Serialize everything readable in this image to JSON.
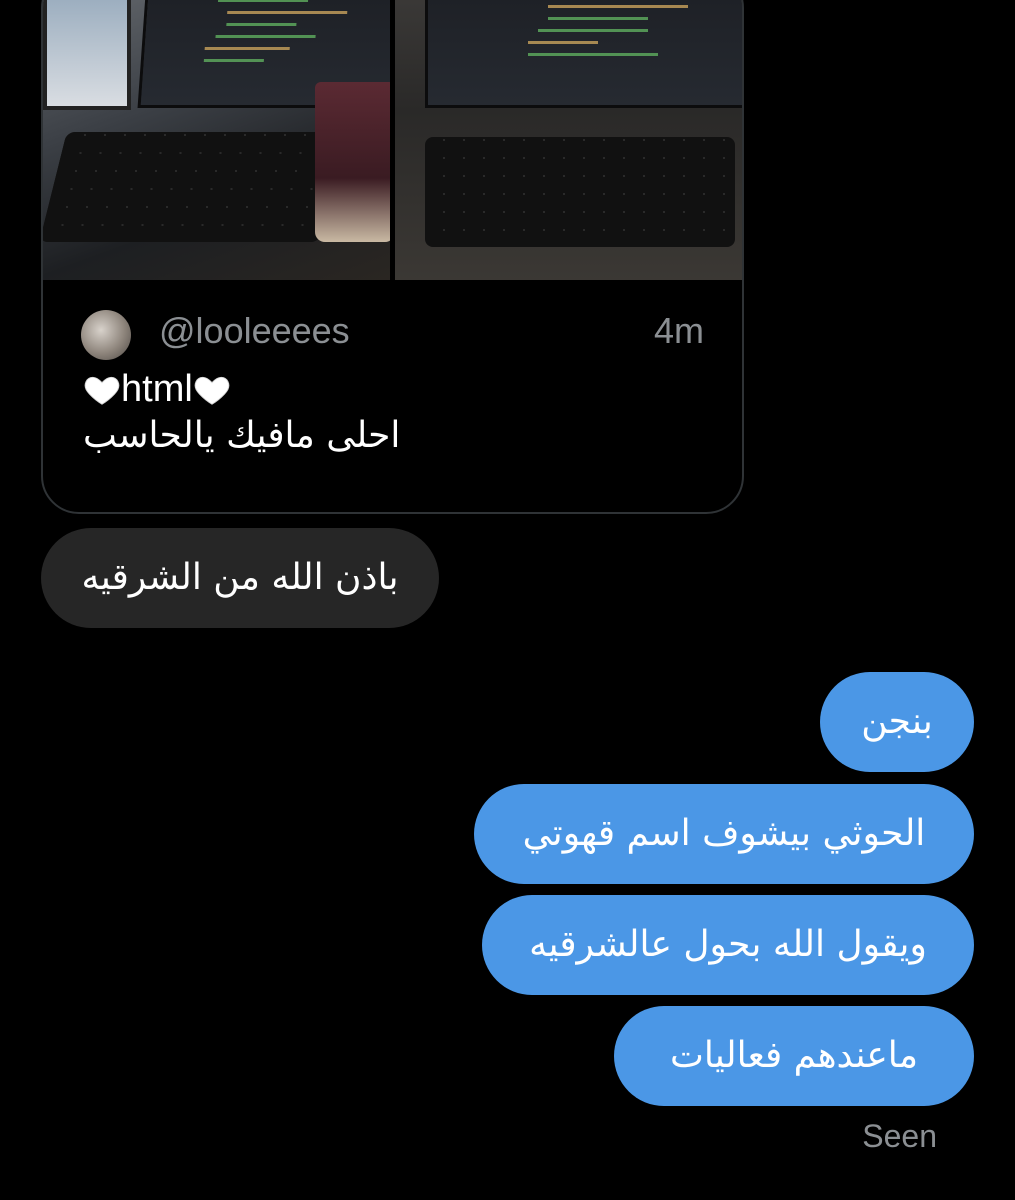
{
  "quoted_tweet": {
    "handle": "@looleeees",
    "time": "4m",
    "text_line1": "html",
    "text_line2": "احلى مافيك يالحاسب",
    "emoji": "white-heart"
  },
  "messages": [
    {
      "direction": "incoming",
      "text": "باذن الله من الشرقيه"
    },
    {
      "direction": "outgoing",
      "text": "بنجن"
    },
    {
      "direction": "outgoing",
      "text": "الحوثي بيشوف اسم قهوتي"
    },
    {
      "direction": "outgoing",
      "text": "ويقول الله بحول عالشرقيه"
    },
    {
      "direction": "outgoing",
      "text": "ماعندهم فعاليات"
    }
  ],
  "status": {
    "seen_label": "Seen"
  },
  "colors": {
    "background": "#000000",
    "incoming_bubble": "#262626",
    "outgoing_bubble": "#4b97e6",
    "muted_text": "#8b8f93"
  }
}
